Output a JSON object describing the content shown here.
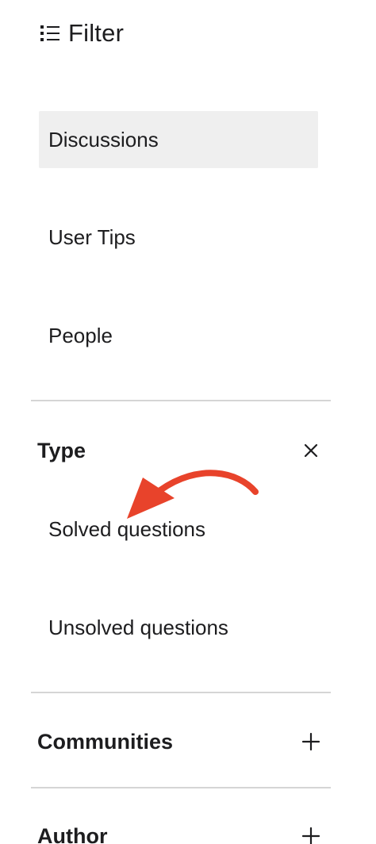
{
  "header": {
    "title": "Filter",
    "icon": "list-filter-icon"
  },
  "scope": {
    "items": [
      {
        "label": "Discussions",
        "active": true
      },
      {
        "label": "User Tips",
        "active": false
      },
      {
        "label": "People",
        "active": false
      }
    ]
  },
  "facets": {
    "type": {
      "title": "Type",
      "state": "expanded",
      "toggle_icon": "close-icon",
      "options": [
        {
          "label": "Solved questions"
        },
        {
          "label": "Unsolved questions"
        }
      ]
    },
    "communities": {
      "title": "Communities",
      "state": "collapsed",
      "toggle_icon": "plus-icon"
    },
    "author": {
      "title": "Author",
      "state": "collapsed",
      "toggle_icon": "plus-icon"
    }
  },
  "colors": {
    "text": "#1d1d1f",
    "active_background": "#efefef",
    "divider": "#d5d5d5",
    "annotation_arrow": "#e8432b"
  }
}
